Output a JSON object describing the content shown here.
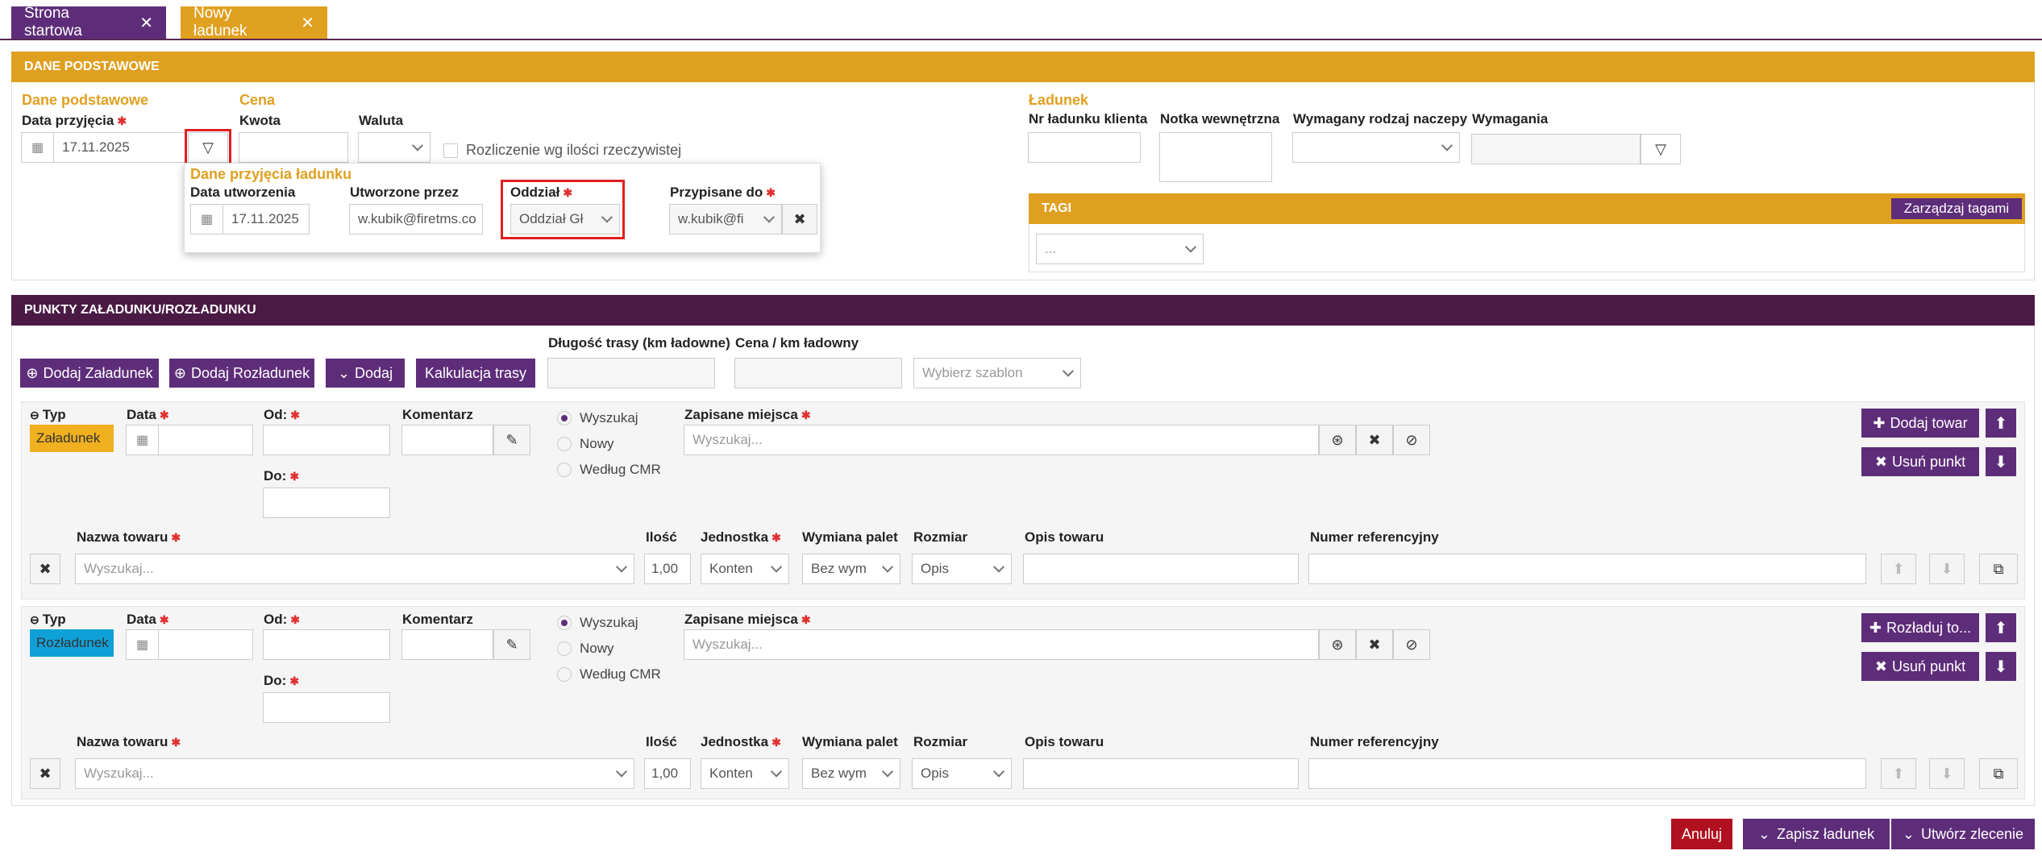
{
  "tabs": [
    {
      "label": "Strona startowa",
      "color": "#5e2d79"
    },
    {
      "label": "Nowy ładunek",
      "color": "#e0a020"
    }
  ],
  "colors": {
    "purple": "#5e2d79",
    "gold": "#dfa020",
    "dark_purple": "#4a1a45",
    "danger": "#b01020",
    "loading": "#f0b020",
    "unloading": "#10a0d8"
  },
  "basic": {
    "header": "DANE PODSTAWOWE",
    "group_title": "Dane podstawowe",
    "date_label": "Data przyjęcia",
    "date_value": "17.11.2025",
    "price_title": "Cena",
    "amount_label": "Kwota",
    "currency_label": "Waluta",
    "settlement_label": "Rozliczenie wg ilości rzeczywistej",
    "cargo_title": "Ładunek",
    "client_nr_label": "Nr ładunku klienta",
    "internal_note_label": "Notka wewnętrzna",
    "trailer_label": "Wymagany rodzaj naczepy",
    "requirements_label": "Wymagania",
    "tags_header": "TAGI",
    "manage_tags": "Zarządzaj tagami",
    "tags_placeholder": "..."
  },
  "popup": {
    "title": "Dane przyjęcia ładunku",
    "created_label": "Data utworzenia",
    "created_value": "17.11.2025",
    "created_by_label": "Utworzone przez",
    "created_by_value": "w.kubik@firetms.co",
    "branch_label": "Oddział",
    "branch_value": "Oddział Gł",
    "assigned_label": "Przypisane do",
    "assigned_value": "w.kubik@fi"
  },
  "points": {
    "header": "PUNKTY ZAŁADUNKU/ROZŁADUNKU",
    "add_loading": "Dodaj Załadunek",
    "add_unloading": "Dodaj Rozładunek",
    "add": "Dodaj",
    "route_calc": "Kalkulacja trasy",
    "route_len_label": "Długość trasy (km ładowne)",
    "price_km_label": "Cena / km ładowny",
    "template_placeholder": "Wybierz szablon",
    "rows": [
      {
        "type_label": "Typ",
        "type_value": "Załadunek",
        "date_label": "Data",
        "from_label": "Od:",
        "to_label": "Do:",
        "comment_label": "Komentarz",
        "radio_search": "Wyszukaj",
        "radio_new": "Nowy",
        "radio_cmr": "Według CMR",
        "places_label": "Zapisane miejsca",
        "places_placeholder": "Wyszukaj...",
        "goods_button": "Dodaj towar",
        "remove_button": "Usuń punkt",
        "goods_name_label": "Nazwa towaru",
        "goods_name_placeholder": "Wyszukaj...",
        "qty_label": "Ilość",
        "qty_value": "1,00",
        "unit_label": "Jednostka",
        "unit_value": "Konten",
        "pallet_label": "Wymiana palet",
        "pallet_value": "Bez wym",
        "size_label": "Rozmiar",
        "size_value": "Opis",
        "desc_label": "Opis towaru",
        "ref_label": "Numer referencyjny"
      },
      {
        "type_label": "Typ",
        "type_value": "Rozładunek",
        "date_label": "Data",
        "from_label": "Od:",
        "to_label": "Do:",
        "comment_label": "Komentarz",
        "radio_search": "Wyszukaj",
        "radio_new": "Nowy",
        "radio_cmr": "Według CMR",
        "places_label": "Zapisane miejsca",
        "places_placeholder": "Wyszukaj...",
        "goods_button": "Rozładuj to...",
        "remove_button": "Usuń punkt",
        "goods_name_label": "Nazwa towaru",
        "goods_name_placeholder": "Wyszukaj...",
        "qty_label": "Ilość",
        "qty_value": "1,00",
        "unit_label": "Jednostka",
        "unit_value": "Konten",
        "pallet_label": "Wymiana palet",
        "pallet_value": "Bez wym",
        "size_label": "Rozmiar",
        "size_value": "Opis",
        "desc_label": "Opis towaru",
        "ref_label": "Numer referencyjny"
      }
    ]
  },
  "footer": {
    "cancel": "Anuluj",
    "save": "Zapisz ładunek",
    "create_order": "Utwórz zlecenie"
  }
}
